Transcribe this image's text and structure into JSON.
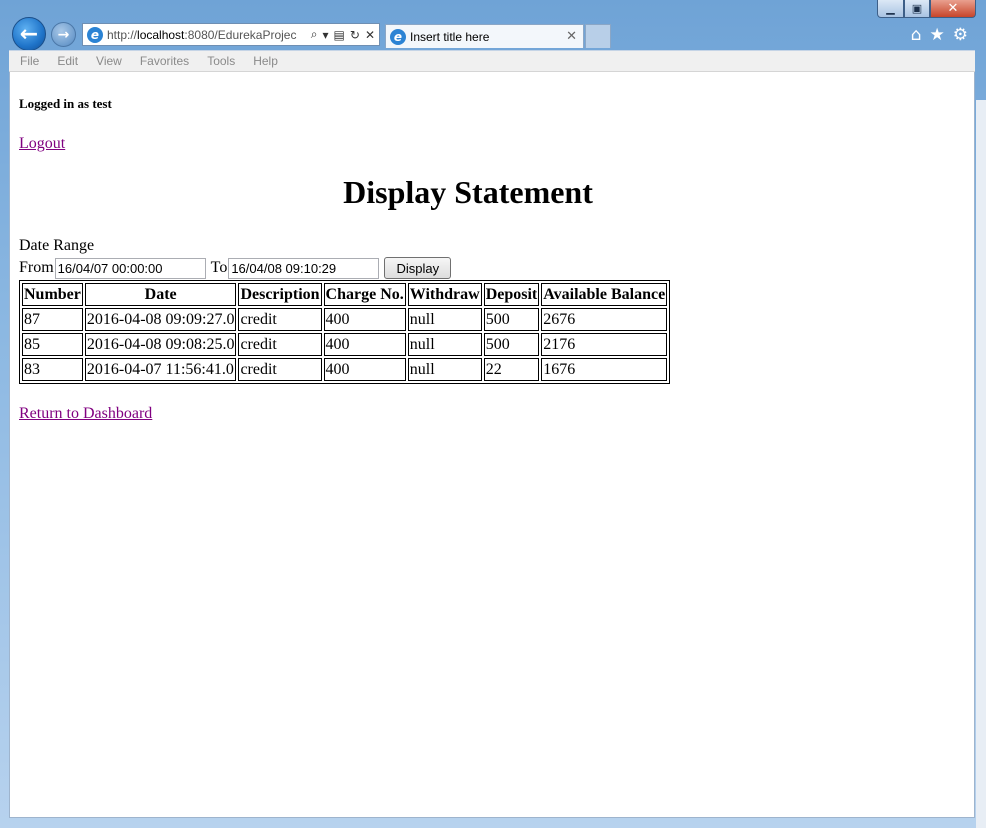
{
  "browser": {
    "address": {
      "scheme": "http://",
      "host": "localhost",
      "rest": ":8080/EdurekaProjec"
    },
    "tab_title": "Insert title here",
    "menu": [
      "File",
      "Edit",
      "View",
      "Favorites",
      "Tools",
      "Help"
    ]
  },
  "page": {
    "logged_in": "Logged in as test",
    "logout": "Logout",
    "title": "Display Statement",
    "date_range_label": "Date Range",
    "from_label": "From",
    "from_value": "16/04/07 00:00:00",
    "to_label": "To",
    "to_value": "16/04/08 09:10:29",
    "display_button": "Display",
    "table": {
      "headers": [
        "Number",
        "Date",
        "Description",
        "Charge No.",
        "Withdraw",
        "Deposit",
        "Available Balance"
      ],
      "rows": [
        [
          "87",
          "2016-04-08 09:09:27.0",
          "credit",
          "400",
          "null",
          "500",
          "2676"
        ],
        [
          "85",
          "2016-04-08 09:08:25.0",
          "credit",
          "400",
          "null",
          "500",
          "2176"
        ],
        [
          "83",
          "2016-04-07 11:56:41.0",
          "credit",
          "400",
          "null",
          "22",
          "1676"
        ]
      ]
    },
    "return_link": "Return to Dashboard"
  }
}
